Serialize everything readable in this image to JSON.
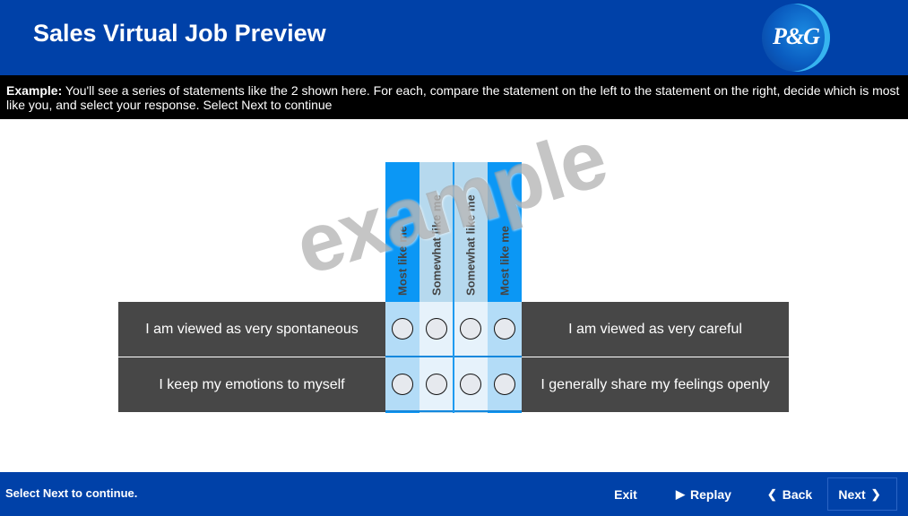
{
  "header": {
    "title": "Sales Virtual Job Preview",
    "logo_text": "P&G",
    "brand_color": "#0041a8"
  },
  "instructions": {
    "lead": "Example:",
    "text": " You'll see a series of statements like the 2 shown here. For each, compare the statement on the left to the statement on the right, decide which is most like you, and select your response. Select Next to continue"
  },
  "scale": {
    "columns": [
      {
        "label": "Most like me"
      },
      {
        "label": "Somewhat like me"
      },
      {
        "label": "Somewhat like me"
      },
      {
        "label": "Most like me"
      }
    ]
  },
  "items": [
    {
      "left": "I am viewed as very spontaneous",
      "right": "I am viewed as very careful",
      "selected": null
    },
    {
      "left": "I keep my emotions to myself",
      "right": "I generally share my feelings openly",
      "selected": null
    }
  ],
  "watermark": "example",
  "footer": {
    "status": "Select Next to continue.",
    "exit_label": "Exit",
    "replay_label": "Replay",
    "back_label": "Back",
    "next_label": "Next",
    "replay_icon": "play-icon",
    "back_icon": "chevron-left-icon",
    "next_icon": "chevron-right-icon"
  }
}
